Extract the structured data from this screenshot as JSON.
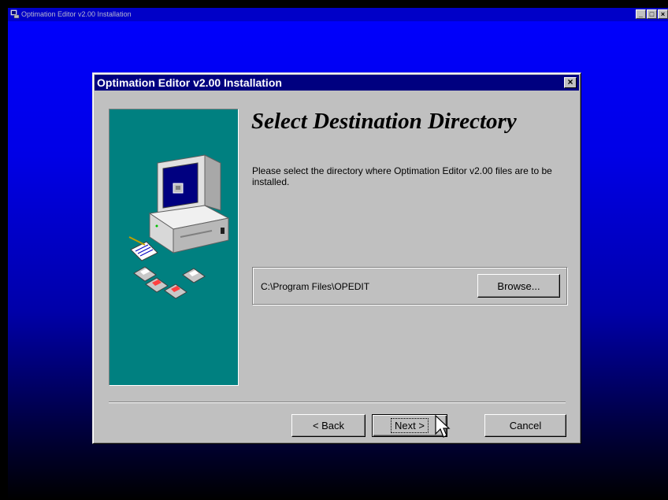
{
  "window": {
    "title": "Optimation Editor v2.00 Installation",
    "controls": [
      "_",
      "□",
      "×"
    ]
  },
  "dialog": {
    "title": "Optimation Editor v2.00 Installation",
    "close_label": "×",
    "heading": "Select Destination Directory",
    "description": "Please select the directory where Optimation Editor v2.00 files are to be installed.",
    "destination_path": "C:\\Program Files\\OPEDIT",
    "browse_label": "Browse...",
    "back_label": "< Back",
    "next_label": "Next >",
    "cancel_label": "Cancel",
    "side_panel_color": "#008080",
    "title_bar_color": "#000080"
  },
  "icons": [
    "app-icon",
    "computer-icon",
    "notepad-icon",
    "floppy-disks-icon",
    "mouse-cursor-icon"
  ]
}
